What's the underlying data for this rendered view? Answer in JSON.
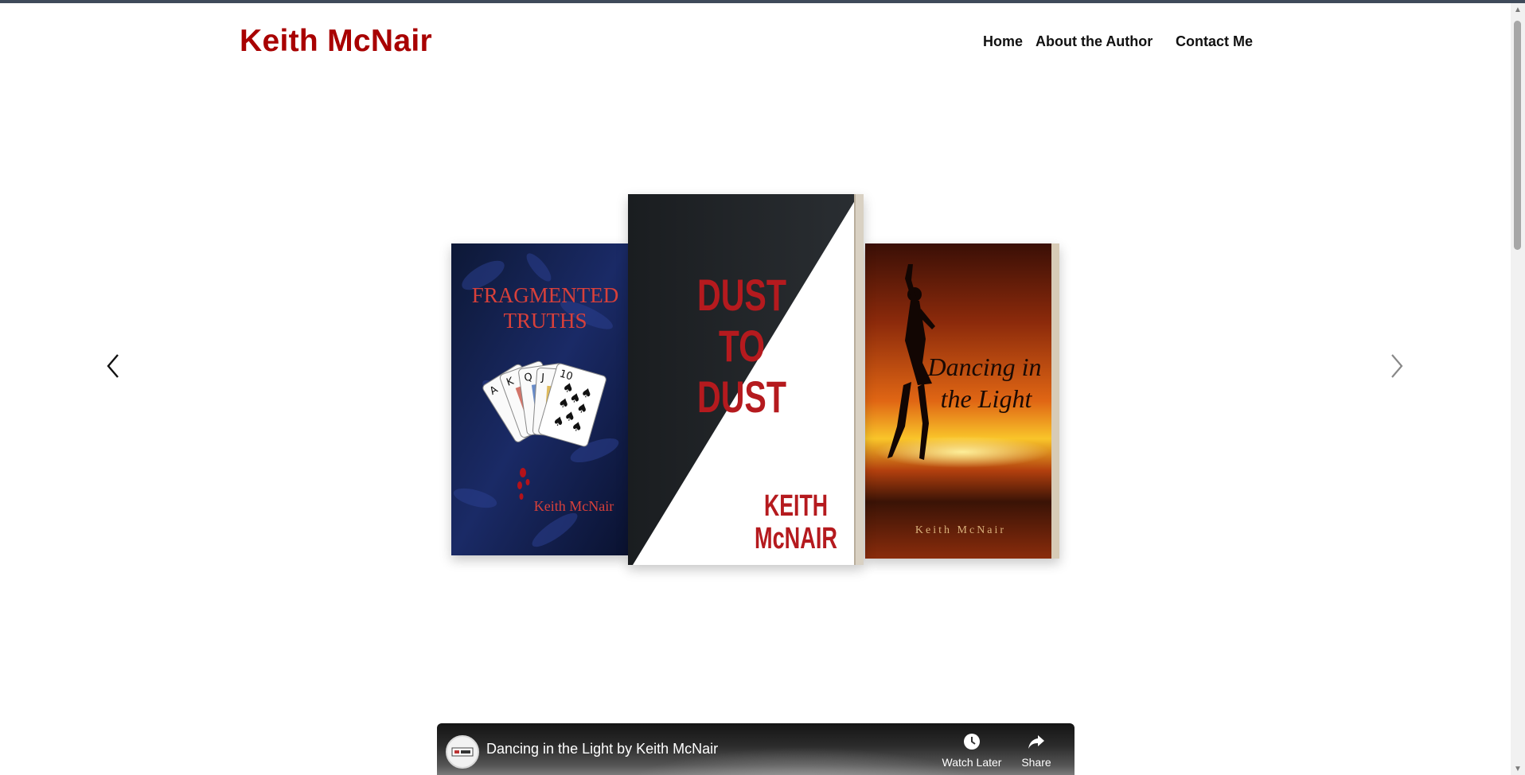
{
  "header": {
    "site_title": "Keith McNair",
    "nav": [
      "Home",
      "About the Author",
      "Contact Me"
    ]
  },
  "carousel": {
    "prev_icon": "chevron-left-icon",
    "next_icon": "chevron-right-icon",
    "books": [
      {
        "title_line1": "FRAGMENTED",
        "title_line2": "TRUTHS",
        "author": "Keith McNair"
      },
      {
        "title_line1": "DUST",
        "title_line2": "TO",
        "title_line3": "DUST",
        "author_line1": "KEITH",
        "author_line2": "McNAIR"
      },
      {
        "title_line1": "Dancing in",
        "title_line2": "the Light",
        "author": "Keith McNair"
      }
    ]
  },
  "video": {
    "title": "Dancing in the Light by Keith McNair",
    "watch_later": "Watch Later",
    "share": "Share",
    "watch_icon": "clock-icon",
    "share_icon": "share-icon"
  },
  "colors": {
    "brand_red": "#a80000",
    "nav_text": "#111111",
    "scrollbar_thumb": "#a7a7a7"
  }
}
